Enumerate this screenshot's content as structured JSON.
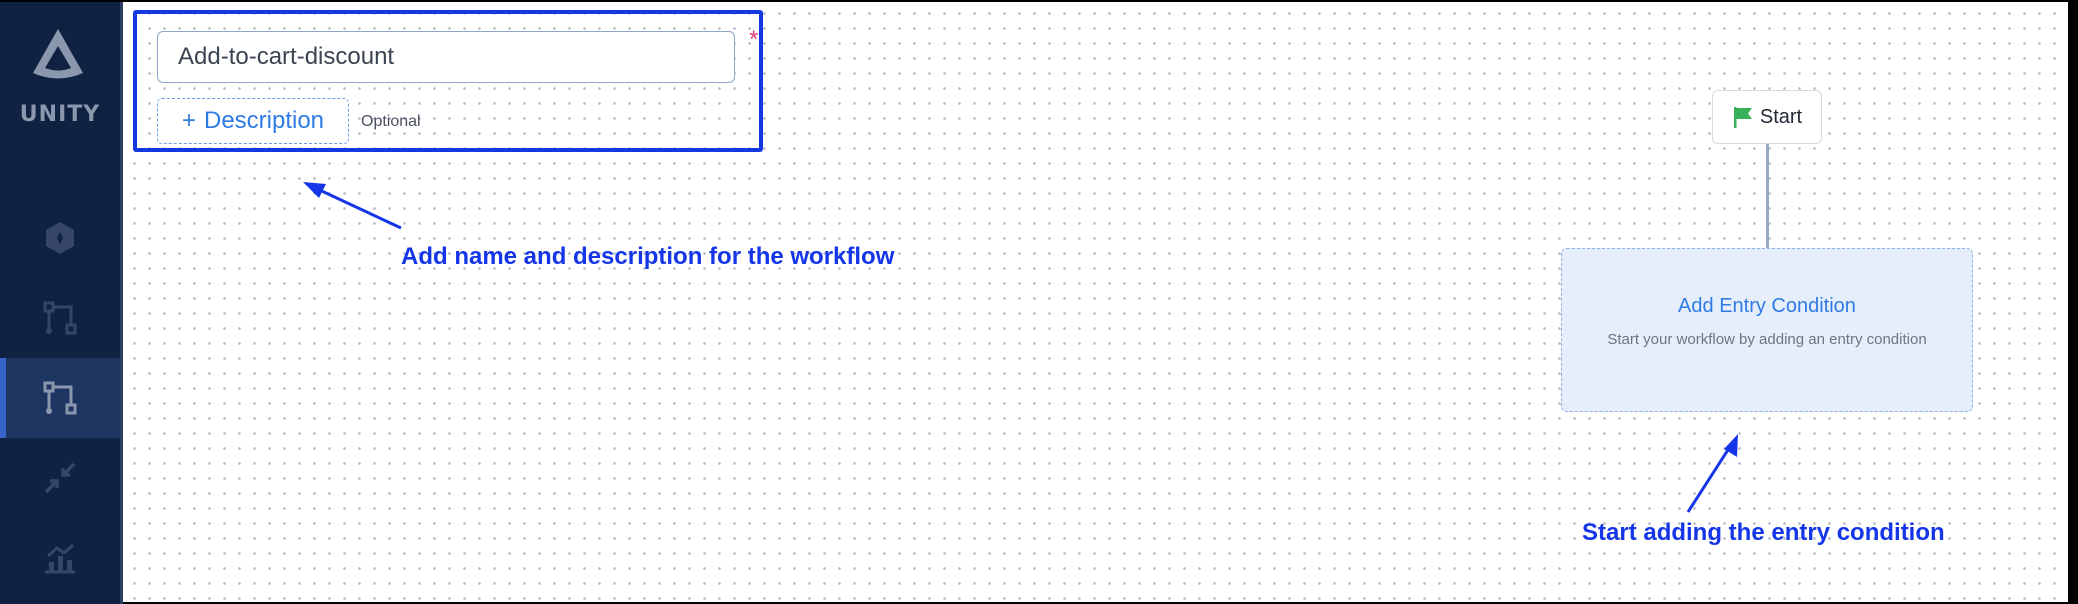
{
  "sidebar": {
    "brand": "UNITY",
    "items": [
      {
        "icon": "hexagon-icon",
        "active": false
      },
      {
        "icon": "workflow-icon",
        "active": false
      },
      {
        "icon": "workflow-icon",
        "active": true
      },
      {
        "icon": "collapse-arrows-icon",
        "active": false
      },
      {
        "icon": "analytics-chart-icon",
        "active": false
      }
    ]
  },
  "workflow_form": {
    "name_value": "Add-to-cart-discount",
    "required_marker": "*",
    "description_button_icon": "+",
    "description_button_label": "Description",
    "optional_label": "Optional"
  },
  "annotations": {
    "name_hint": "Add name and description for the workflow",
    "entry_hint": "Start adding the entry condition"
  },
  "canvas": {
    "start_node_label": "Start",
    "start_flag_color": "#37b25a",
    "entry_card_title": "Add Entry Condition",
    "entry_card_subtitle": "Start your workflow by adding an entry condition"
  },
  "colors": {
    "sidebar_bg": "#0f2242",
    "annotation_blue": "#1436e8",
    "link_blue": "#2f7be6",
    "required_red": "#e0407a"
  }
}
